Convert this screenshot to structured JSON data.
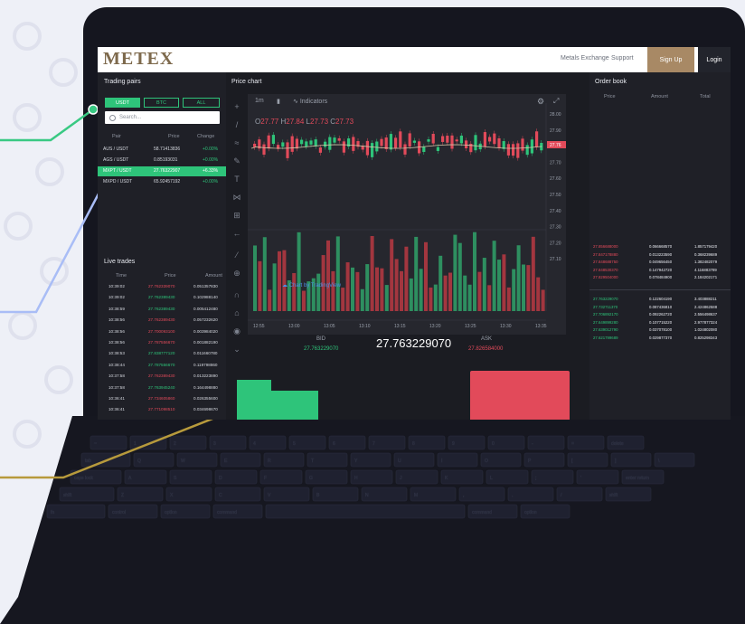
{
  "header": {
    "logo": "METEX",
    "nav": [
      "Metals Exchange",
      "Support"
    ],
    "signup": "Sign Up",
    "login": "Login"
  },
  "trading_pairs": {
    "title": "Trading pairs",
    "tabs": [
      {
        "label": "USDT",
        "active": true
      },
      {
        "label": "BTC",
        "active": false
      },
      {
        "label": "ALL",
        "active": false
      }
    ],
    "search_placeholder": "Search...",
    "columns": [
      "Pair",
      "Price",
      "Change"
    ],
    "rows": [
      {
        "pair": "AUS / USDT",
        "price": "58.71413836",
        "change": "+0.00%",
        "selected": false
      },
      {
        "pair": "AGS / USDT",
        "price": "0.85193031",
        "change": "+0.00%",
        "selected": false
      },
      {
        "pair": "MXPT / USDT",
        "price": "27.76322907",
        "change": "+6.33%",
        "selected": true
      },
      {
        "pair": "MXPD / USDT",
        "price": "65.92457192",
        "change": "+0.00%",
        "selected": false
      }
    ]
  },
  "price_chart": {
    "title": "Price chart",
    "timeframe": "1m",
    "indicators_label": "Indicators",
    "ohlc": {
      "o_label": "O",
      "o": "27.77",
      "h_label": "H",
      "h": "27.84",
      "l_label": "L",
      "l": "27.73",
      "c_label": "C",
      "c": "27.73"
    },
    "price_ticks": [
      "28.00",
      "27.90",
      "27.80",
      "27.70",
      "27.60",
      "27.50",
      "27.40",
      "27.30",
      "27.20",
      "27.10"
    ],
    "current_price_tag": "27.76",
    "time_ticks": [
      "12:55",
      "13:00",
      "13:05",
      "13:10",
      "13:15",
      "13:20",
      "13:25",
      "13:30",
      "13:35"
    ],
    "watermark": "Chart by TradingView",
    "bid_label": "BID",
    "bid_value": "27.763229070",
    "mid_price": "27.763229070",
    "ask_label": "ASK",
    "ask_value": "27.826584000"
  },
  "live_trades": {
    "title": "Live trades",
    "columns": [
      "Time",
      "Price",
      "Amount"
    ],
    "rows": [
      {
        "time": "10:39:02",
        "price": "27.762339070",
        "amount": "0.051357830",
        "side": "sell"
      },
      {
        "time": "10:39:02",
        "price": "27.762389430",
        "amount": "0.102988140",
        "side": "buy"
      },
      {
        "time": "10:38:59",
        "price": "27.762389430",
        "amount": "0.005412480",
        "side": "buy"
      },
      {
        "time": "10:38:56",
        "price": "27.762389430",
        "amount": "0.057232620",
        "side": "sell"
      },
      {
        "time": "10:38:56",
        "price": "27.700093100",
        "amount": "0.003984020",
        "side": "sell"
      },
      {
        "time": "10:38:56",
        "price": "27.787556670",
        "amount": "0.001882190",
        "side": "sell"
      },
      {
        "time": "10:38:53",
        "price": "27.838777120",
        "amount": "0.011660780",
        "side": "buy"
      },
      {
        "time": "10:38:44",
        "price": "27.787556670",
        "amount": "0.119798860",
        "side": "buy"
      },
      {
        "time": "10:37:58",
        "price": "27.762389430",
        "amount": "0.013223890",
        "side": "sell"
      },
      {
        "time": "10:37:58",
        "price": "27.763945240",
        "amount": "0.164498880",
        "side": "buy"
      },
      {
        "time": "10:36:41",
        "price": "27.734605860",
        "amount": "0.026355600",
        "side": "sell"
      },
      {
        "time": "10:36:41",
        "price": "27.771098510",
        "amount": "0.034698670",
        "side": "sell"
      }
    ]
  },
  "order_book": {
    "title": "Order book",
    "columns": [
      "Price",
      "Amount",
      "Total"
    ],
    "asks": [
      {
        "price": "27.856688000",
        "amount": "0.066668570",
        "total": "1.857179420"
      },
      {
        "price": "27.847178880",
        "amount": "0.013223590",
        "total": "0.368239689"
      },
      {
        "price": "27.848688750",
        "amount": "0.049656450",
        "total": "1.382482079"
      },
      {
        "price": "27.848530370",
        "amount": "0.147942720",
        "total": "4.116883789"
      },
      {
        "price": "27.829504000",
        "amount": "0.078484900",
        "total": "2.184202171"
      }
    ],
    "bids": [
      {
        "price": "27.763229070",
        "amount": "0.122604190",
        "total": "3.403888211"
      },
      {
        "price": "27.732711370",
        "amount": "0.087436810",
        "total": "2.424862588"
      },
      {
        "price": "27.706892170",
        "amount": "0.092262720",
        "total": "2.556498637"
      },
      {
        "price": "27.649899280",
        "amount": "0.107715220",
        "total": "2.977877324"
      },
      {
        "price": "27.639012790",
        "amount": "0.037078100",
        "total": "1.024802080"
      },
      {
        "price": "27.621799689",
        "amount": "0.029877370",
        "total": "0.825298343"
      }
    ]
  },
  "colors": {
    "green": "#2ec47a",
    "red": "#e24a5a",
    "gold": "#a88965",
    "accent_line_green": "#39c983",
    "accent_line_blue": "#a9bdf6",
    "accent_line_gold": "#b79a3c"
  },
  "keyboard": {
    "keys_row1": [
      "~",
      "1",
      "2",
      "3",
      "4",
      "5",
      "6",
      "7",
      "8",
      "9",
      "0",
      "-",
      "=",
      "delete"
    ],
    "keys_row2": [
      "tab",
      "Q",
      "W",
      "E",
      "R",
      "T",
      "Y",
      "U",
      "I",
      "O",
      "P",
      "[",
      "]",
      "\\"
    ],
    "keys_row3": [
      "caps lock",
      "A",
      "S",
      "D",
      "F",
      "G",
      "H",
      "J",
      "K",
      "L",
      ";",
      "'",
      "enter return"
    ],
    "keys_row4": [
      "shift",
      "Z",
      "X",
      "C",
      "V",
      "B",
      "N",
      "M",
      ",",
      ".",
      "/",
      "shift"
    ],
    "keys_row5": [
      "fn",
      "control",
      "option",
      "command",
      "",
      "command",
      "option"
    ]
  }
}
